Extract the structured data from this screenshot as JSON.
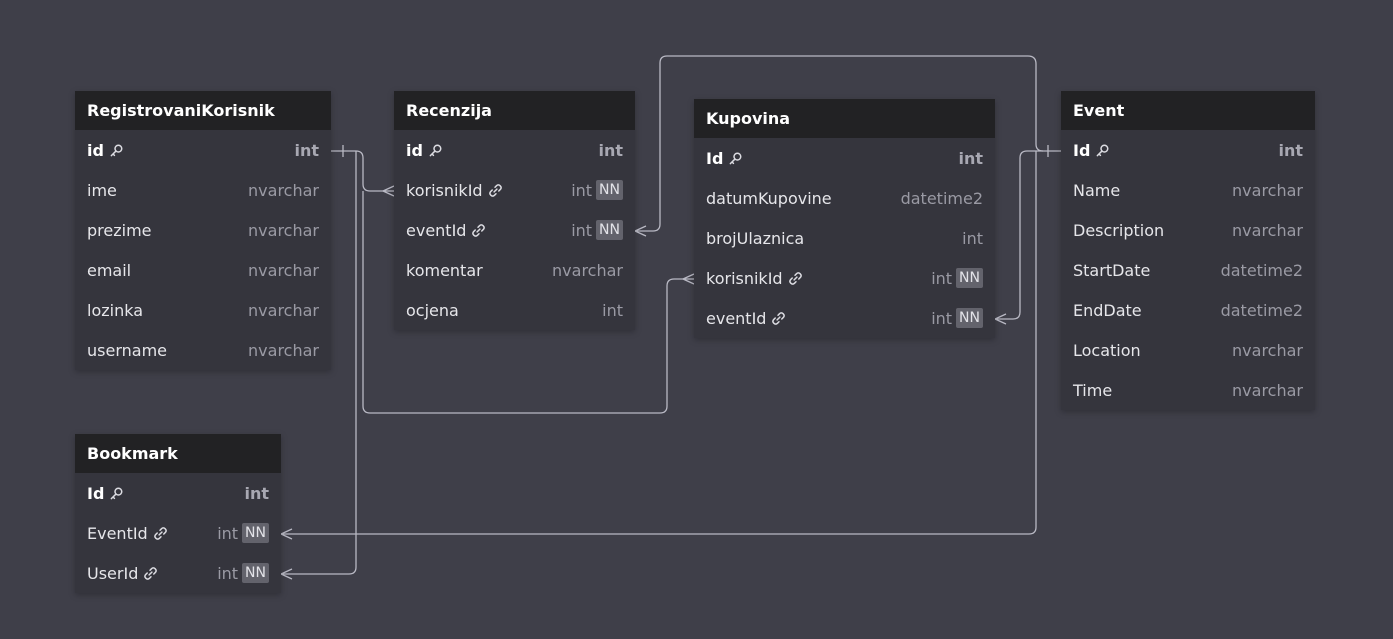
{
  "tables": [
    {
      "id": "registrovanikorisnik",
      "name": "RegistrovaniKorisnik",
      "fields": [
        {
          "name": "id",
          "type": "int",
          "pk": true,
          "fk": false,
          "nn": false
        },
        {
          "name": "ime",
          "type": "nvarchar",
          "pk": false,
          "fk": false,
          "nn": false
        },
        {
          "name": "prezime",
          "type": "nvarchar",
          "pk": false,
          "fk": false,
          "nn": false
        },
        {
          "name": "email",
          "type": "nvarchar",
          "pk": false,
          "fk": false,
          "nn": false
        },
        {
          "name": "lozinka",
          "type": "nvarchar",
          "pk": false,
          "fk": false,
          "nn": false
        },
        {
          "name": "username",
          "type": "nvarchar",
          "pk": false,
          "fk": false,
          "nn": false
        }
      ]
    },
    {
      "id": "recenzija",
      "name": "Recenzija",
      "fields": [
        {
          "name": "id",
          "type": "int",
          "pk": true,
          "fk": false,
          "nn": false
        },
        {
          "name": "korisnikId",
          "type": "int",
          "pk": false,
          "fk": true,
          "nn": true
        },
        {
          "name": "eventId",
          "type": "int",
          "pk": false,
          "fk": true,
          "nn": true
        },
        {
          "name": "komentar",
          "type": "nvarchar",
          "pk": false,
          "fk": false,
          "nn": false
        },
        {
          "name": "ocjena",
          "type": "int",
          "pk": false,
          "fk": false,
          "nn": false
        }
      ]
    },
    {
      "id": "kupovina",
      "name": "Kupovina",
      "fields": [
        {
          "name": "Id",
          "type": "int",
          "pk": true,
          "fk": false,
          "nn": false
        },
        {
          "name": "datumKupovine",
          "type": "datetime2",
          "pk": false,
          "fk": false,
          "nn": false
        },
        {
          "name": "brojUlaznica",
          "type": "int",
          "pk": false,
          "fk": false,
          "nn": false
        },
        {
          "name": "korisnikId",
          "type": "int",
          "pk": false,
          "fk": true,
          "nn": true
        },
        {
          "name": "eventId",
          "type": "int",
          "pk": false,
          "fk": true,
          "nn": true
        }
      ]
    },
    {
      "id": "event",
      "name": "Event",
      "fields": [
        {
          "name": "Id",
          "type": "int",
          "pk": true,
          "fk": false,
          "nn": false
        },
        {
          "name": "Name",
          "type": "nvarchar",
          "pk": false,
          "fk": false,
          "nn": false
        },
        {
          "name": "Description",
          "type": "nvarchar",
          "pk": false,
          "fk": false,
          "nn": false
        },
        {
          "name": "StartDate",
          "type": "datetime2",
          "pk": false,
          "fk": false,
          "nn": false
        },
        {
          "name": "EndDate",
          "type": "datetime2",
          "pk": false,
          "fk": false,
          "nn": false
        },
        {
          "name": "Location",
          "type": "nvarchar",
          "pk": false,
          "fk": false,
          "nn": false
        },
        {
          "name": "Time",
          "type": "nvarchar",
          "pk": false,
          "fk": false,
          "nn": false
        }
      ]
    },
    {
      "id": "bookmark",
      "name": "Bookmark",
      "fields": [
        {
          "name": "Id",
          "type": "int",
          "pk": true,
          "fk": false,
          "nn": false
        },
        {
          "name": "EventId",
          "type": "int",
          "pk": false,
          "fk": true,
          "nn": true
        },
        {
          "name": "UserId",
          "type": "int",
          "pk": false,
          "fk": true,
          "nn": true
        }
      ]
    }
  ],
  "nn_label": "NN",
  "colors": {
    "canvas": "#3f3f49",
    "table_header": "#222224",
    "table_body": "#35353d",
    "connector": "#b9b9c4"
  },
  "icons": {
    "primary_key": "key-icon",
    "foreign_key": "link-icon"
  }
}
